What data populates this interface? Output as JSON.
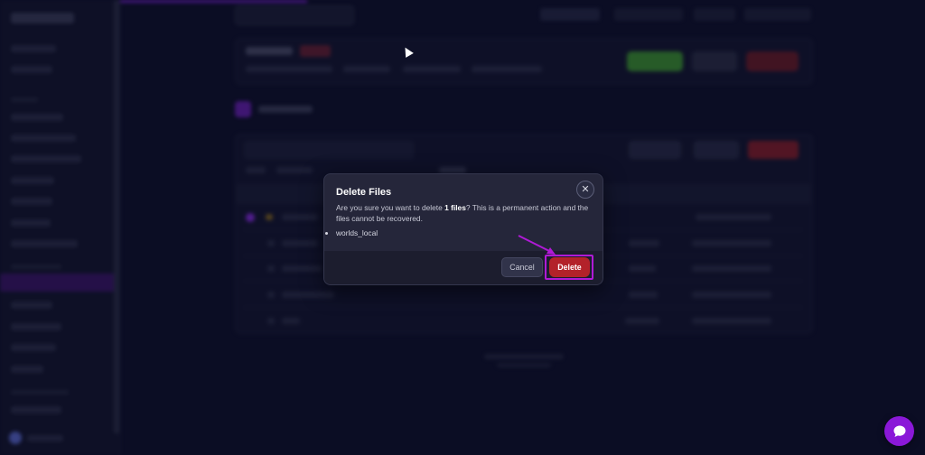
{
  "modal": {
    "title": "Delete Files",
    "message_prefix": "Are you sure you want to delete ",
    "message_count": "1 files",
    "message_suffix": "? This is a permanent action and the files cannot be recovered.",
    "files": [
      "worlds_local"
    ],
    "close_icon": "close-icon",
    "cancel_label": "Cancel",
    "delete_label": "Delete"
  },
  "colors": {
    "accent": "#8a18d8",
    "delete": "#b3222a",
    "highlight": "#b01ad6",
    "background": "#0b0d24"
  },
  "chat": {
    "icon": "chat-bubble-icon"
  }
}
